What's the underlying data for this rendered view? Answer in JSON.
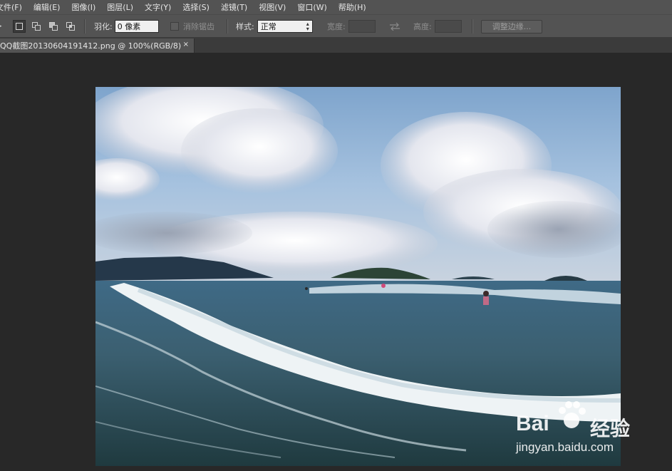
{
  "menu": {
    "items": [
      {
        "label": "文件(F)",
        "name": "menu-file"
      },
      {
        "label": "编辑(E)",
        "name": "menu-edit"
      },
      {
        "label": "图像(I)",
        "name": "menu-image"
      },
      {
        "label": "图层(L)",
        "name": "menu-layer"
      },
      {
        "label": "文字(Y)",
        "name": "menu-type"
      },
      {
        "label": "选择(S)",
        "name": "menu-select"
      },
      {
        "label": "滤镜(T)",
        "name": "menu-filter"
      },
      {
        "label": "视图(V)",
        "name": "menu-view"
      },
      {
        "label": "窗口(W)",
        "name": "menu-window"
      },
      {
        "label": "帮助(H)",
        "name": "menu-help"
      }
    ]
  },
  "options": {
    "feather_label": "羽化:",
    "feather_value": "0 像素",
    "antialias_label": "消除锯齿",
    "style_label": "样式:",
    "style_value": "正常",
    "width_label": "宽度:",
    "height_label": "高度:",
    "refine_edge_label": "调整边缘..."
  },
  "document": {
    "tab_title": "QQ截图20130604191412.png @ 100%(RGB/8)",
    "close_glyph": "×"
  },
  "watermark": {
    "brand": "Bai",
    "brand_suffix": "经验",
    "url": "jingyan.baidu.com"
  },
  "colors": {
    "ui_background": "#535353",
    "canvas_background": "#282828"
  }
}
